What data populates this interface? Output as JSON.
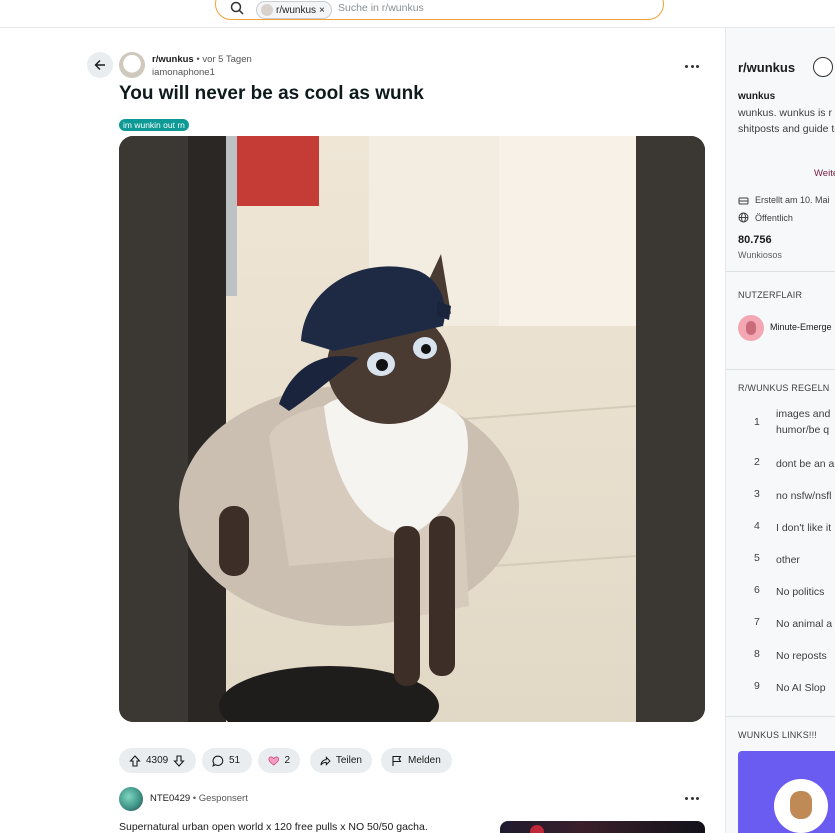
{
  "search": {
    "chip_label": "r/wunkus",
    "placeholder": "Suche in r/wunkus"
  },
  "post": {
    "subreddit": "r/wunkus",
    "time": "vor 5 Tagen",
    "separator": "•",
    "author": "iamonaphone1",
    "title": "You will never be as cool as wunk",
    "flair": "im wunkin out rn",
    "actions": {
      "upvotes": "4309",
      "comments": "51",
      "awards": "2",
      "share": "Teilen",
      "report": "Melden"
    }
  },
  "ad": {
    "author": "NTE0429",
    "sponsored": "Gesponsert",
    "text": "Supernatural urban open world x 120 free pulls x NO 50/50 gacha."
  },
  "sidebar": {
    "title": "r/wunkus",
    "subtitle": "wunkus",
    "description": "wunkus. wunkus is r video shitposts and guide to a good wu",
    "more": "Weite",
    "created": "Erstellt am 10. Mai",
    "visibility": "Öffentlich",
    "members_count": "80.756",
    "members_label": "Wunkiosos",
    "user_flair_heading": "NUTZERFLAIR",
    "user_flair_name": "Minute-Emerge",
    "rules_heading": "R/WUNKUS REGELN",
    "rules": [
      {
        "n": "1",
        "text": "images and",
        "text2": "humor/be q"
      },
      {
        "n": "2",
        "text": "dont be an a"
      },
      {
        "n": "3",
        "text": "no nsfw/nsfl"
      },
      {
        "n": "4",
        "text": "I don't like it"
      },
      {
        "n": "5",
        "text": "other"
      },
      {
        "n": "6",
        "text": "No politics"
      },
      {
        "n": "7",
        "text": "No animal a"
      },
      {
        "n": "8",
        "text": "No reposts"
      },
      {
        "n": "9",
        "text": "No AI Slop"
      }
    ],
    "links_heading": "WUNKUS LINKS!!!"
  },
  "colors": {
    "search_border": "#f0a236",
    "flair_bg": "#0d9a96",
    "pill_bg": "#eaedef",
    "sidebar_bg": "#f7f8f9",
    "more_link": "#7a1f3d"
  }
}
